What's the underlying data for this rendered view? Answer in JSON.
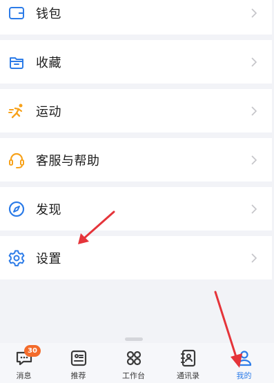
{
  "menu": {
    "items": [
      {
        "label": "钱包",
        "icon": "wallet-icon"
      },
      {
        "label": "收藏",
        "icon": "folder-icon"
      },
      {
        "label": "运动",
        "icon": "running-icon"
      },
      {
        "label": "客服与帮助",
        "icon": "headset-icon"
      },
      {
        "label": "发现",
        "icon": "compass-icon"
      },
      {
        "label": "设置",
        "icon": "gear-icon"
      }
    ]
  },
  "tabbar": {
    "tabs": [
      {
        "label": "消息",
        "icon": "message-icon",
        "badge": "30"
      },
      {
        "label": "推荐",
        "icon": "recommend-icon"
      },
      {
        "label": "工作台",
        "icon": "workbench-icon"
      },
      {
        "label": "通讯录",
        "icon": "contacts-icon"
      },
      {
        "label": "我的",
        "icon": "person-icon",
        "active": true
      }
    ]
  },
  "colors": {
    "accent": "#2b7be8",
    "icon_orange": "#f7a21b",
    "badge": "#f36b2b",
    "arrow": "#e5343a",
    "background": "#f2f3f7"
  }
}
